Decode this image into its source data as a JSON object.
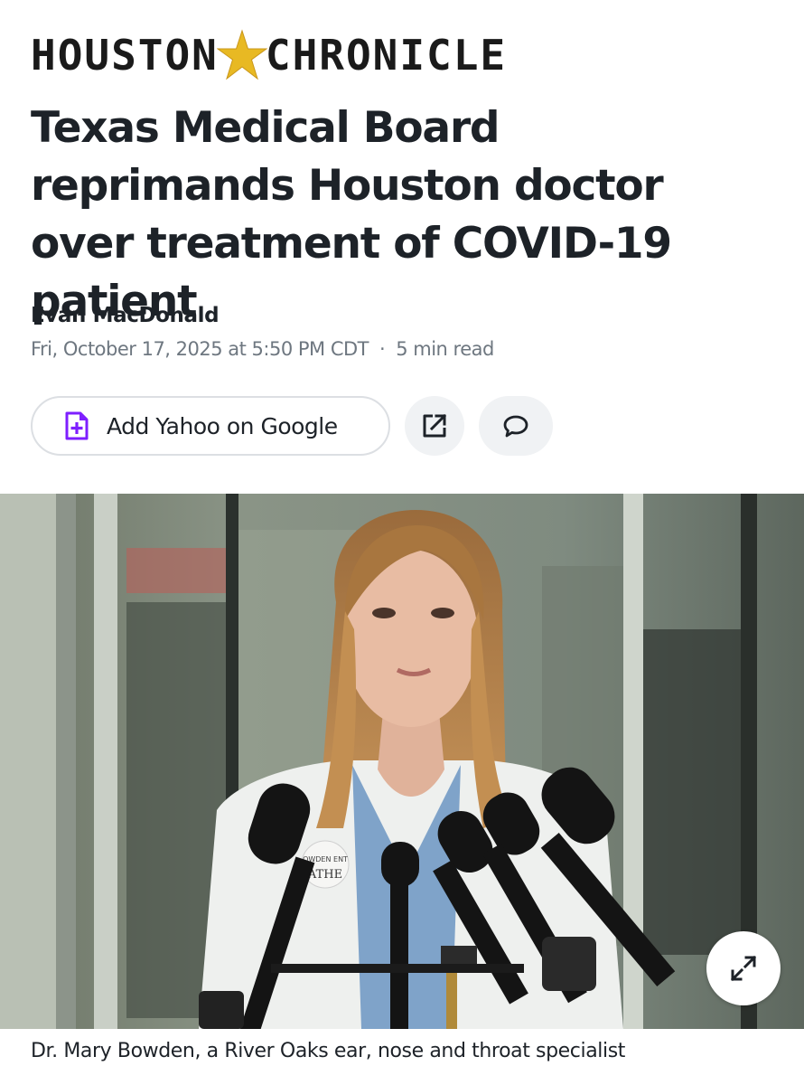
{
  "masthead": {
    "word_left": "HOUSTON",
    "word_right": "CHRONICLE",
    "star_color": "#e8b923"
  },
  "article": {
    "headline": "Texas Medical Board reprimands Houston doctor over treatment of COVID-19 patient",
    "author": "Evan MacDonald",
    "date": "Fri, October 17, 2025 at 5:50 PM CDT",
    "separator": "·",
    "read_time": "5 min read"
  },
  "actions": {
    "add_google_label": "Add Yahoo on Google",
    "add_google_icon": "add-document-icon",
    "share_icon": "share-icon",
    "comment_icon": "comment-icon",
    "accent": "#7e1fff"
  },
  "photo": {
    "expand_icon": "expand-icon",
    "coat_text_top": "OWDEN ENT",
    "coat_text_bottom": "ATHE"
  },
  "caption": "Dr. Mary Bowden, a River Oaks ear, nose and throat specialist"
}
